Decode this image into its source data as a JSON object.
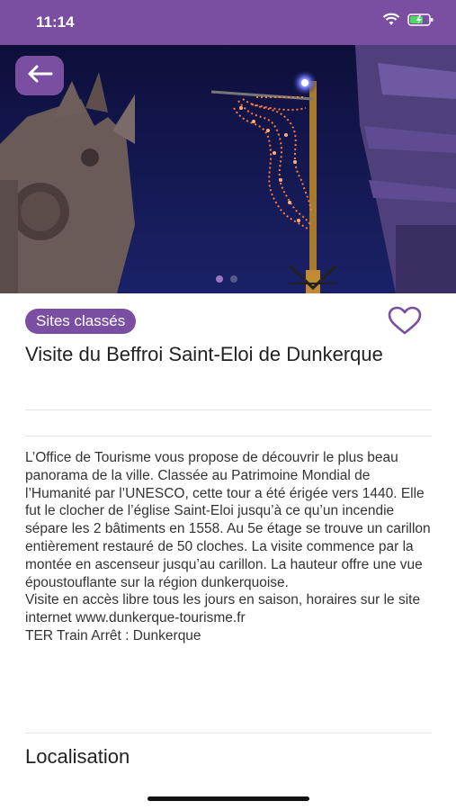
{
  "status_bar": {
    "time": "11:14"
  },
  "carousel": {
    "page_count": 2,
    "active_page": 1
  },
  "detail": {
    "category": "Sites classés",
    "title": "Visite du Beffroi Saint-Eloi de Dunkerque",
    "description": "L’Office de Tourisme vous propose de découvrir le plus beau panorama de la ville. Classée au Patrimoine Mondial de l’Humanité par l’UNESCO, cette tour a été érigée vers 1440. Elle fut le clocher de l’église Saint-Eloi jusqu’à ce qu’un incendie sépare les 2 bâtiments en 1558. Au 5e étage se trouve un carillon entièrement restauré de 50 cloches. La visite commence par la montée en ascenseur jusqu’au carillon. La hauteur offre une vue époustouflante sur la région dunkerquoise.\nVisite en accès libre tous les jours en saison, horaires sur le site internet www.dunkerque-tourisme.fr\nTER Train Arrêt : Dunkerque",
    "location_heading": "Localisation"
  },
  "colors": {
    "brand": "#7a4ea0",
    "sky": "#0f1242"
  }
}
